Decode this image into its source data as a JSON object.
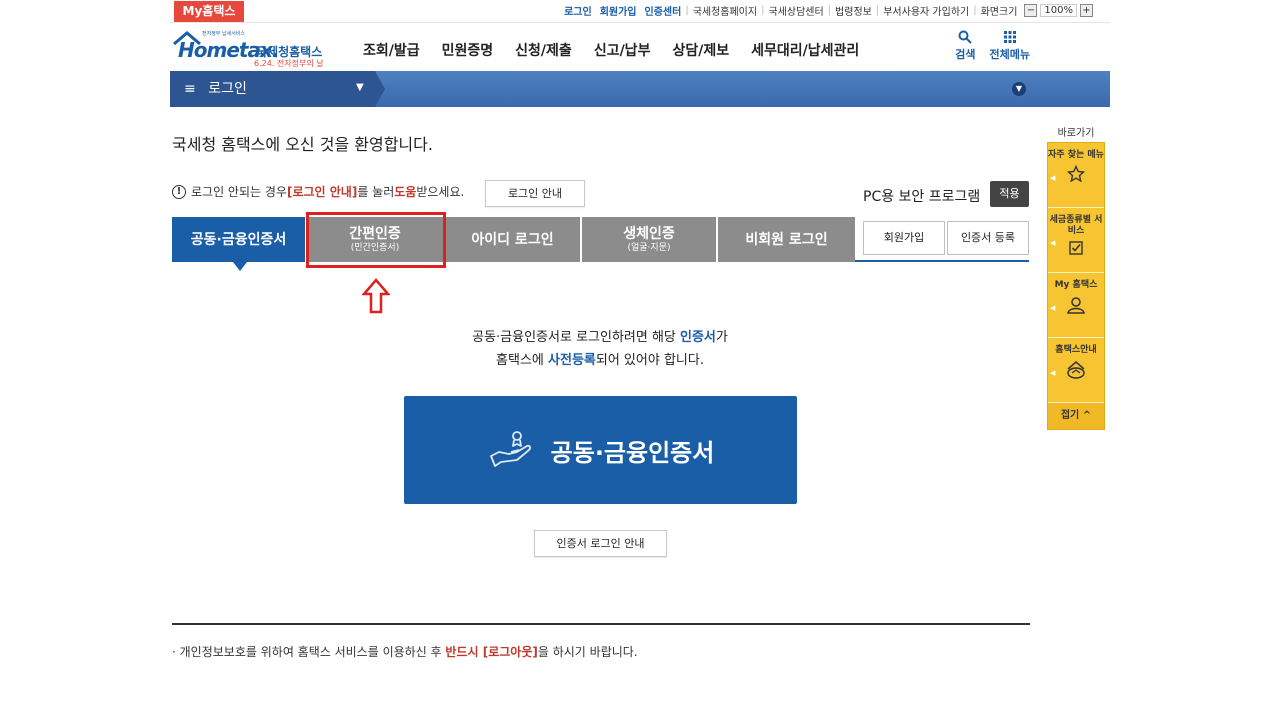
{
  "util": {
    "my_hometax": "My홈택스",
    "links": [
      {
        "label": "로그인",
        "strong": true
      },
      {
        "label": "회원가입",
        "strong": true
      },
      {
        "label": "인증센터",
        "strong": true
      },
      {
        "label": "국세청홈페이지",
        "strong": false
      },
      {
        "label": "국세상담센터",
        "strong": false
      },
      {
        "label": "법령정보",
        "strong": false
      },
      {
        "label": "부서사용자 가입하기",
        "strong": false
      },
      {
        "label": "화면크기",
        "strong": false
      }
    ],
    "zoom_minus": "−",
    "zoom_value": "100%",
    "zoom_plus": "+"
  },
  "logo": {
    "main": "Hometax.",
    "sub": "국세청홈택스",
    "tag": "6.24. 전자정부의 날",
    "small": "전자정부 납세서비스"
  },
  "gnb": [
    "조회/발급",
    "민원증명",
    "신청/제출",
    "신고/납부",
    "상담/제보",
    "세무대리/납세관리"
  ],
  "header_icons": {
    "search": "검색",
    "all_menu": "전체메뉴"
  },
  "breadcrumb": {
    "menu_glyph": "≡",
    "label": "로그인",
    "caret": "▼",
    "expand": "▼"
  },
  "welcome": "국세청 홈택스에 오신 것을 환영합니다.",
  "help": {
    "icon": "!",
    "pre": "로그인 안되는 경우 ",
    "emph1": "[로그인 안내]",
    "mid": "를 눌러 ",
    "emph2": "도움",
    "post": "받으세요.",
    "button": "로그인 안내"
  },
  "security": {
    "label": "PC용 보안 프로그램",
    "apply": "적용"
  },
  "tabs": [
    {
      "label": "공동·금융인증서",
      "sub": "",
      "active": true
    },
    {
      "label": "간편인증",
      "sub": "(민간인증서)",
      "active": false
    },
    {
      "label": "아이디 로그인",
      "sub": "",
      "active": false
    },
    {
      "label": "생체인증",
      "sub": "(얼굴·지문)",
      "active": false
    },
    {
      "label": "비회원 로그인",
      "sub": "",
      "active": false
    }
  ],
  "side_buttons": {
    "signup": "회원가입",
    "cert_register": "인증서 등록"
  },
  "info": {
    "line1_pre": "공동·금융인증서로 로그인하려면 해당 ",
    "line1_emph": "인증서",
    "line1_post": "가",
    "line2_pre": "홈택스에 ",
    "line2_emph": "사전등록",
    "line2_post": "되어 있어야 합니다."
  },
  "cert_button": "공동·금융인증서",
  "guide_button": "인증서 로그인 안내",
  "footnote": {
    "bullet": "·",
    "pre": " 개인정보보호를 위하여 홈택스 서비스를 이용하신 후 ",
    "emph": "반드시 [로그아웃]",
    "post": "을 하시기 바랍니다."
  },
  "quick": {
    "title": "바로가기",
    "items": [
      "자주 찾는 메뉴",
      "세금종류별 서비스",
      "My 홈택스",
      "홈택스안내"
    ],
    "fold": "접기 ^"
  },
  "colors": {
    "brand_blue": "#1a5ea8",
    "tab_gray": "#8c8c8c",
    "accent_red": "#e01f1f",
    "quick_yellow": "#f7c531"
  }
}
